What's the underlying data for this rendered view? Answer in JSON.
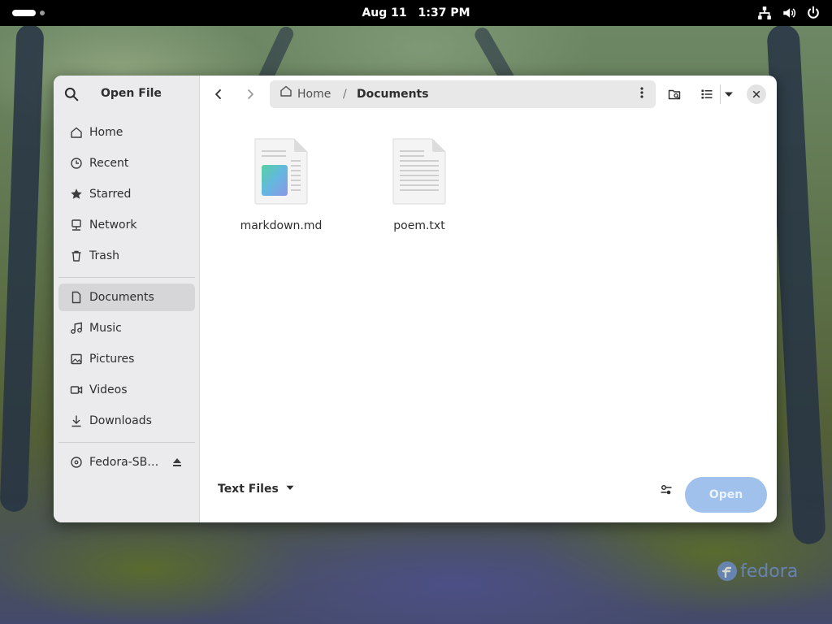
{
  "topbar": {
    "date": "Aug 11",
    "time": "1:37 PM"
  },
  "dialog": {
    "title": "Open File",
    "sidebar": {
      "places": [
        {
          "label": "Home",
          "icon": "home-icon"
        },
        {
          "label": "Recent",
          "icon": "clock-icon"
        },
        {
          "label": "Starred",
          "icon": "star-icon"
        },
        {
          "label": "Network",
          "icon": "network-icon"
        },
        {
          "label": "Trash",
          "icon": "trash-icon"
        }
      ],
      "bookmarks": [
        {
          "label": "Documents",
          "icon": "document-icon",
          "active": true
        },
        {
          "label": "Music",
          "icon": "music-icon"
        },
        {
          "label": "Pictures",
          "icon": "picture-icon"
        },
        {
          "label": "Videos",
          "icon": "video-icon"
        },
        {
          "label": "Downloads",
          "icon": "download-icon"
        }
      ],
      "devices": [
        {
          "label": "Fedora-SB…",
          "icon": "disc-icon"
        }
      ]
    },
    "pathbar": {
      "home": "Home",
      "separator": "/",
      "current": "Documents"
    },
    "files": [
      {
        "name": "markdown.md",
        "type": "markdown"
      },
      {
        "name": "poem.txt",
        "type": "text"
      }
    ],
    "filter_label": "Text Files",
    "open_label": "Open",
    "open_color": "#9fc1ec"
  },
  "wallpaper": {
    "logo_text": "fedora"
  }
}
